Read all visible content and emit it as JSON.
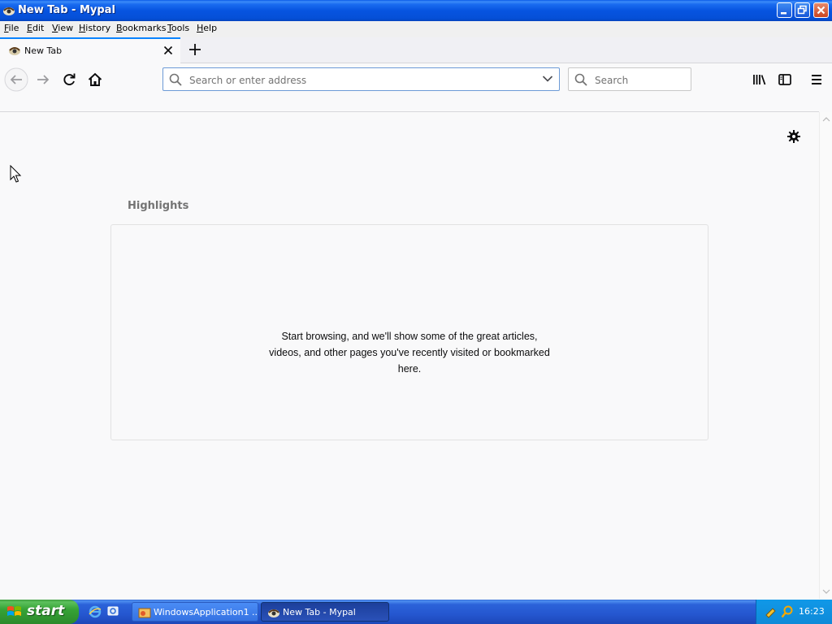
{
  "window": {
    "title": "New Tab - Mypal"
  },
  "menubar": {
    "items": [
      {
        "label": "File",
        "accel": "F",
        "rest": "ile"
      },
      {
        "label": "Edit",
        "accel": "E",
        "rest": "dit"
      },
      {
        "label": "View",
        "accel": "V",
        "rest": "iew"
      },
      {
        "label": "History",
        "accel": "H",
        "rest": "istory"
      },
      {
        "label": "Bookmarks",
        "accel": "B",
        "rest": "ookmarks"
      },
      {
        "label": "Tools",
        "accel": "T",
        "rest": "ools"
      },
      {
        "label": "Help",
        "accel": "H",
        "rest": "elp"
      }
    ]
  },
  "tabs": [
    {
      "title": "New Tab",
      "active": true
    }
  ],
  "toolbar": {
    "url_placeholder": "Search or enter address",
    "url_value": "",
    "search_placeholder": "Search",
    "search_value": ""
  },
  "icons": {
    "back": "back-arrow-icon",
    "forward": "forward-arrow-icon",
    "reload": "reload-icon",
    "home": "home-icon",
    "library": "library-icon",
    "sidebar": "sidebar-icon",
    "menu": "hamburger-menu-icon",
    "settings": "gear-icon"
  },
  "newtab_page": {
    "highlights_title": "Highlights",
    "highlights_message": "Start browsing, and we'll show some of the great articles, videos, and other pages you've recently visited or bookmarked here."
  },
  "taskbar": {
    "start_label": "start",
    "buttons": [
      {
        "label": "WindowsApplication1 ...",
        "active": false
      },
      {
        "label": "New Tab - Mypal",
        "active": true
      }
    ],
    "clock": "16:23"
  },
  "colors": {
    "accent": "#0a84ff",
    "page_bg": "#f9f9fa",
    "xp_title_blue": "#0550d8",
    "xp_start_green": "#36a336"
  }
}
